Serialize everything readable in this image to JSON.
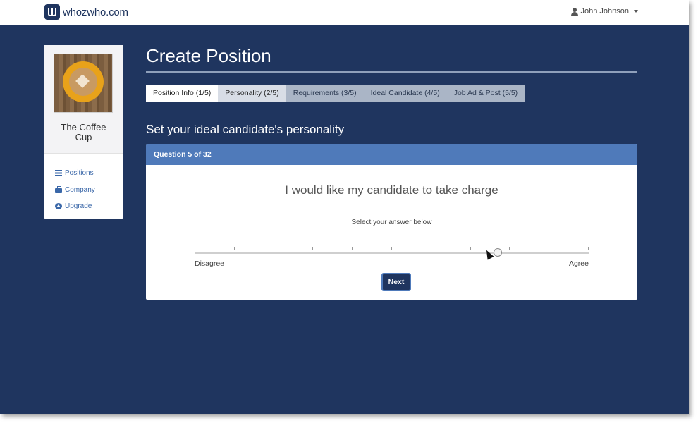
{
  "header": {
    "logo_text": "whozwho.com",
    "user_name": "John Johnson"
  },
  "sidebar": {
    "company_name": "The Coffee Cup",
    "links": [
      {
        "label": "Positions",
        "icon": "list-icon"
      },
      {
        "label": "Company",
        "icon": "briefcase-icon"
      },
      {
        "label": "Upgrade",
        "icon": "upgrade-icon"
      }
    ]
  },
  "main": {
    "title": "Create Position",
    "tabs": [
      {
        "label": "Position Info (1/5)",
        "state": "active"
      },
      {
        "label": "Personality (2/5)",
        "state": "visited"
      },
      {
        "label": "Requirements (3/5)",
        "state": "default"
      },
      {
        "label": "Ideal Candidate (4/5)",
        "state": "default"
      },
      {
        "label": "Job Ad & Post (5/5)",
        "state": "default"
      }
    ],
    "subtitle": "Set your ideal candidate's personality"
  },
  "question_panel": {
    "header": "Question 5 of 32",
    "question": "I would like my candidate to take charge",
    "hint": "Select your answer below",
    "slider": {
      "min_label": "Disagree",
      "max_label": "Agree",
      "steps": 10,
      "value_fraction": 0.77
    },
    "next_label": "Next"
  },
  "colors": {
    "background": "#1f355f",
    "panel_header": "#4f7aba",
    "link": "#3a67a8"
  }
}
